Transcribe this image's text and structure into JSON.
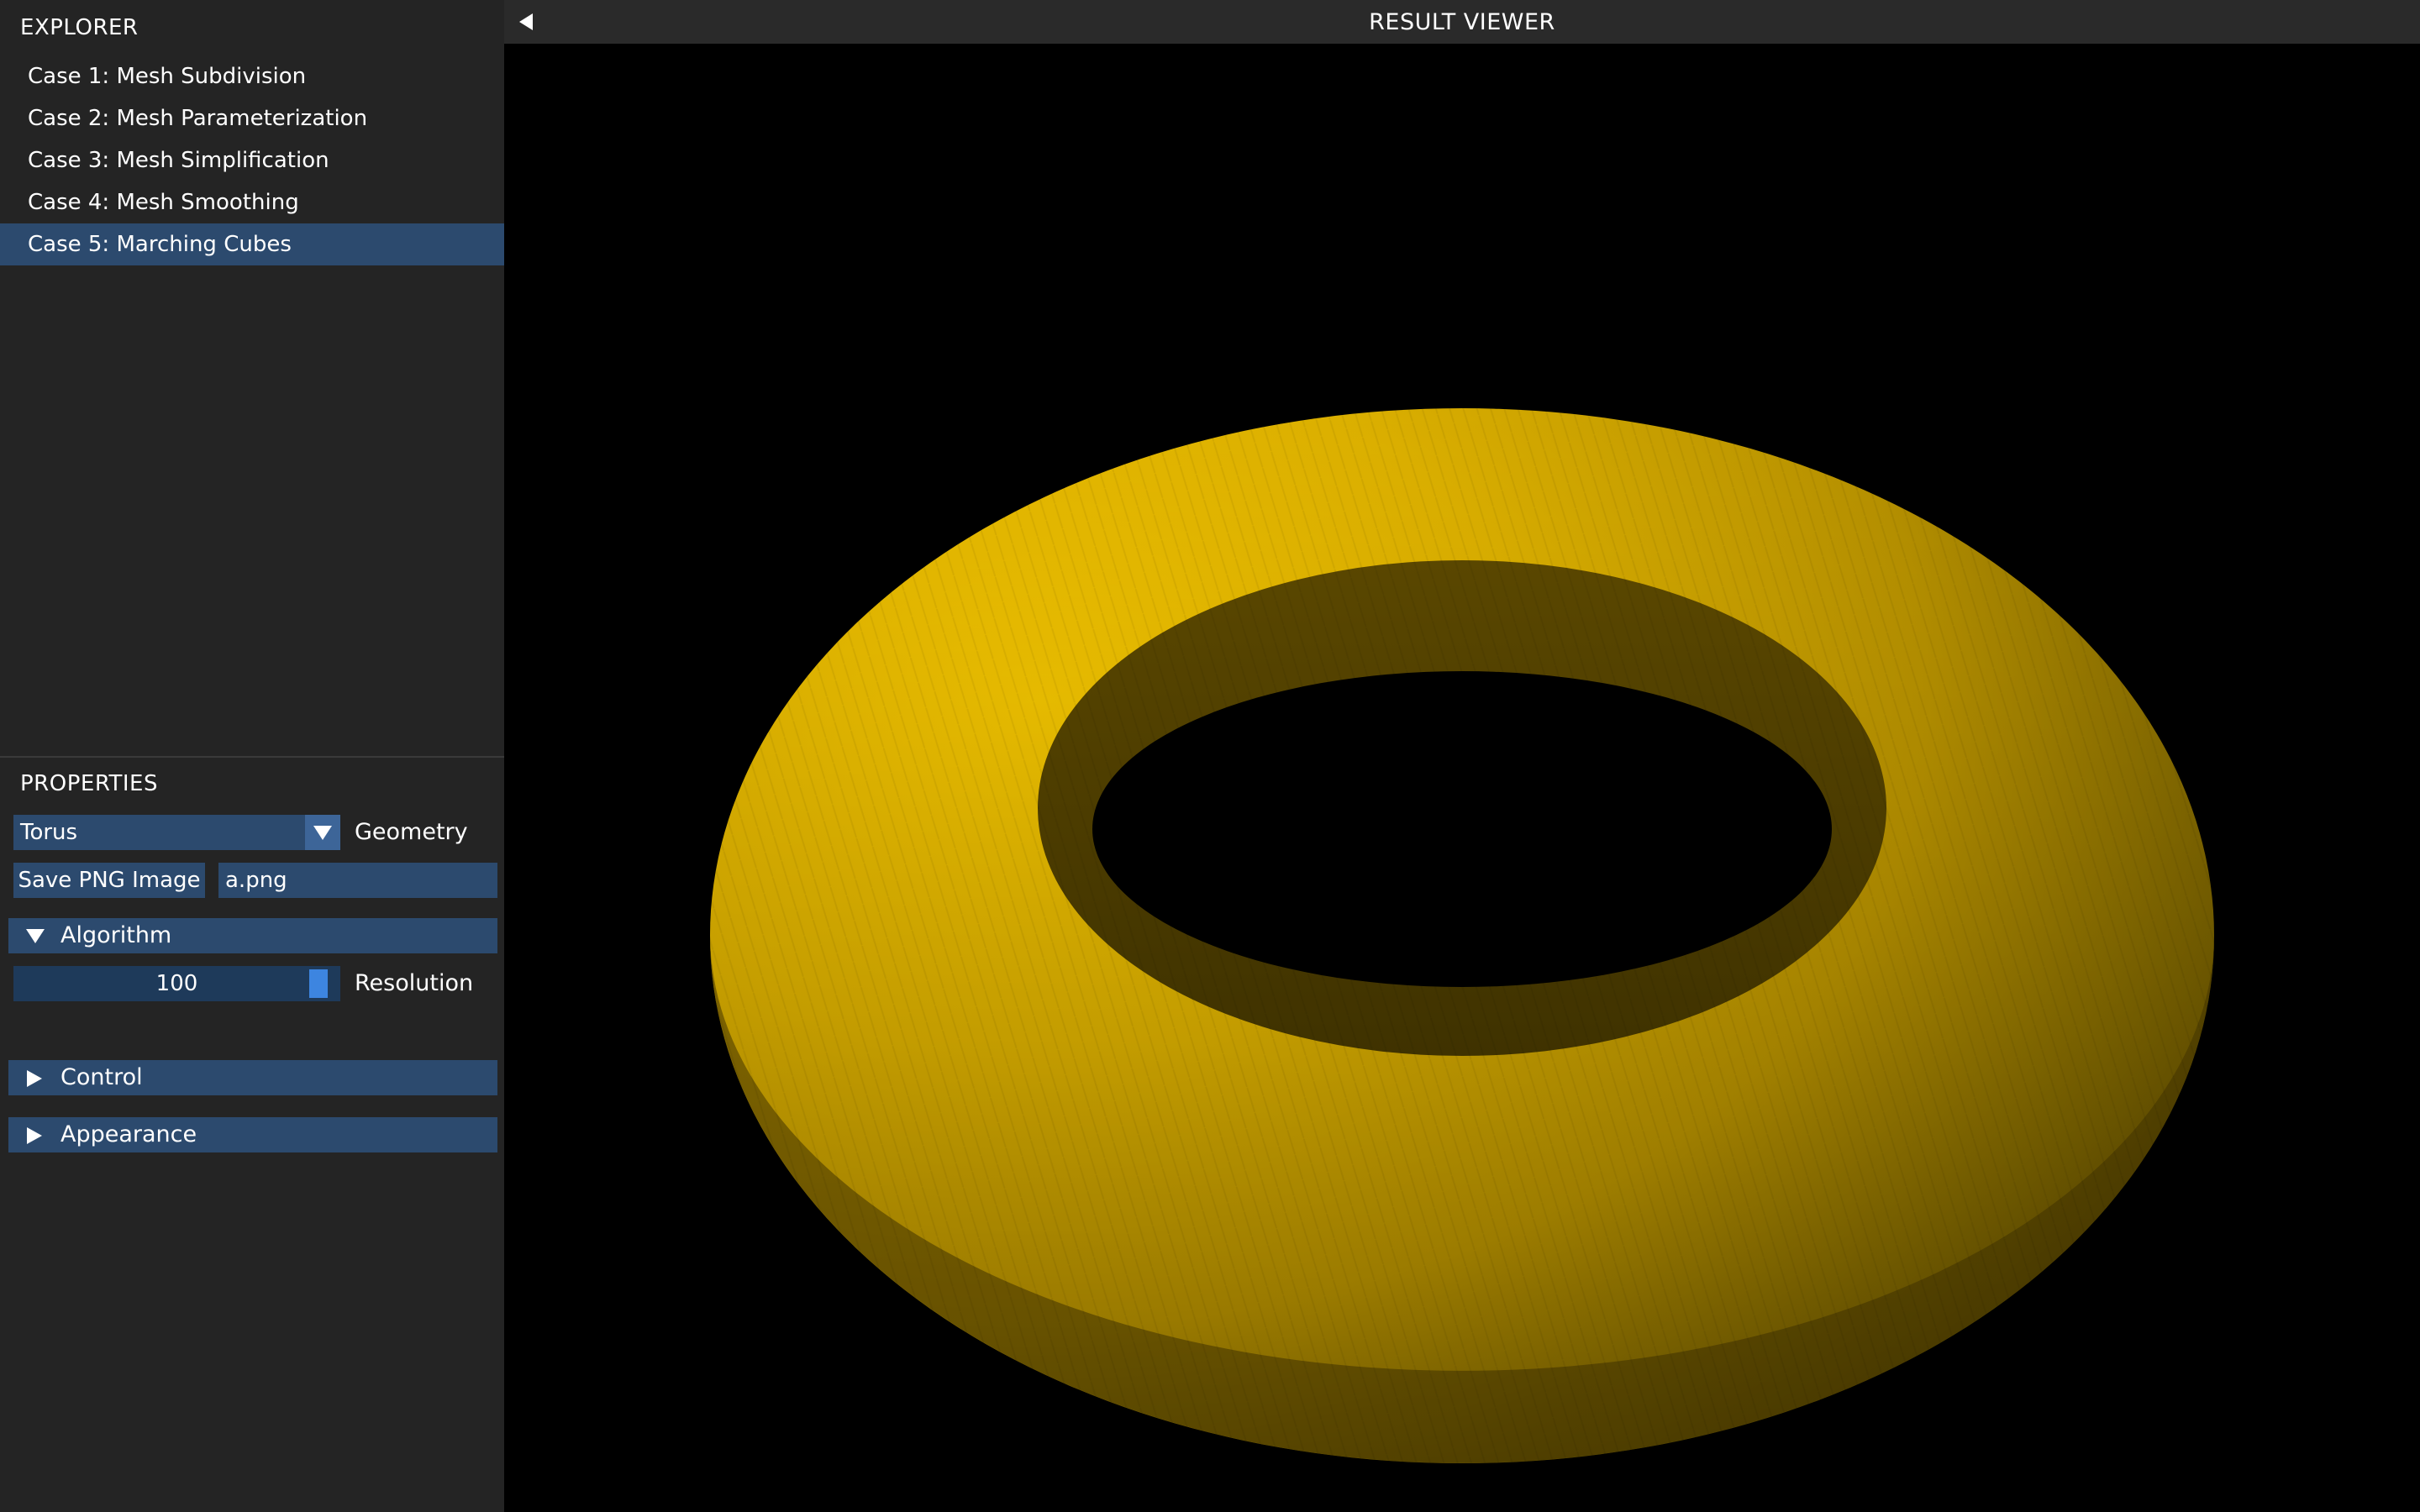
{
  "explorer": {
    "title": "EXPLORER",
    "items": [
      {
        "label": "Case 1: Mesh Subdivision"
      },
      {
        "label": "Case 2: Mesh Parameterization"
      },
      {
        "label": "Case 3: Mesh Simplification"
      },
      {
        "label": "Case 4: Mesh Smoothing"
      },
      {
        "label": "Case 5: Marching Cubes",
        "selected": true
      }
    ]
  },
  "properties": {
    "title": "PROPERTIES",
    "geometry": {
      "value": "Torus",
      "label": "Geometry",
      "icon": "chevron-down-icon"
    },
    "save": {
      "button_label": "Save PNG Image",
      "filename": "a.png"
    },
    "algorithm": {
      "header": "Algorithm",
      "expanded": true,
      "resolution": {
        "value": "100",
        "label": "Resolution",
        "fraction": 0.97
      }
    },
    "control": {
      "header": "Control",
      "expanded": false
    },
    "appearance": {
      "header": "Appearance",
      "expanded": false
    }
  },
  "viewer": {
    "title": "RESULT VIEWER",
    "collapse_icon": "triangle-left-icon",
    "object": "torus"
  },
  "colors": {
    "sidebar_bg": "#242424",
    "accent": "#2c4a6e",
    "accent_active": "#3d85e0",
    "mesh_base": "#e8bc00",
    "viewport_bg": "#000000"
  }
}
